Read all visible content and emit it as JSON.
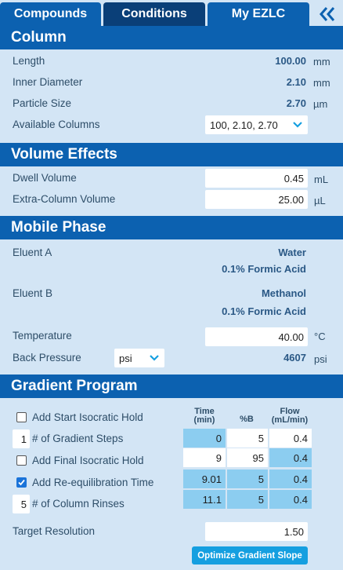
{
  "tabs": [
    {
      "label": "Compounds"
    },
    {
      "label": "Conditions"
    },
    {
      "label": "My EZLC"
    }
  ],
  "collapse_icon": "double-chevron-left-icon",
  "column": {
    "header": "Column",
    "length": {
      "label": "Length",
      "value": "100.00",
      "unit": "mm"
    },
    "inner_diameter": {
      "label": "Inner Diameter",
      "value": "2.10",
      "unit": "mm"
    },
    "particle_size": {
      "label": "Particle Size",
      "value": "2.70",
      "unit": "µm"
    },
    "available_columns": {
      "label": "Available Columns",
      "selected": "100, 2.10, 2.70"
    }
  },
  "volume_effects": {
    "header": "Volume Effects",
    "dwell_volume": {
      "label": "Dwell Volume",
      "value": "0.45",
      "unit": "mL"
    },
    "extra_column_volume": {
      "label": "Extra-Column Volume",
      "value": "25.00",
      "unit": "µL"
    }
  },
  "mobile_phase": {
    "header": "Mobile Phase",
    "eluent_a": {
      "label": "Eluent A",
      "solvent": "Water",
      "additive": "0.1% Formic Acid"
    },
    "eluent_b": {
      "label": "Eluent B",
      "solvent": "Methanol",
      "additive": "0.1% Formic Acid"
    },
    "temperature": {
      "label": "Temperature",
      "value": "40.00",
      "unit": "°C"
    },
    "back_pressure": {
      "label": "Back Pressure",
      "unit_select": "psi",
      "value": "4607",
      "unit": "psi"
    }
  },
  "gradient_program": {
    "header": "Gradient Program",
    "options": [
      {
        "label": "Add Start Isocratic Hold",
        "type": "checkbox",
        "checked": false
      },
      {
        "label": "# of Gradient Steps",
        "type": "number",
        "value": "1"
      },
      {
        "label": "Add Final Isocratic Hold",
        "type": "checkbox",
        "checked": false
      },
      {
        "label": "Add Re-equilibration Time",
        "type": "checkbox",
        "checked": true
      },
      {
        "label": "# of Column Rinses",
        "type": "number",
        "value": "5"
      }
    ],
    "columns": [
      {
        "line1": "Time",
        "line2": "(min)"
      },
      {
        "line1": "%B",
        "line2": ""
      },
      {
        "line1": "Flow",
        "line2": "(mL/min)"
      }
    ],
    "rows": [
      {
        "time": "0",
        "b": "5",
        "flow": "0.4"
      },
      {
        "time": "9",
        "b": "95",
        "flow": "0.4"
      },
      {
        "time": "9.01",
        "b": "5",
        "flow": "0.4"
      },
      {
        "time": "11.1",
        "b": "5",
        "flow": "0.4"
      }
    ],
    "target_resolution": {
      "label": "Target Resolution",
      "value": "1.50"
    },
    "optimize_button": "Optimize Gradient Slope"
  },
  "colors": {
    "panel_bg": "#d3e5f5",
    "header_blue": "#0c61b0",
    "active_tab": "#0a3f78",
    "cell_blue": "#8ccdf0",
    "button_blue": "#159fe0",
    "checkbox_checked": "#1a73d9"
  }
}
